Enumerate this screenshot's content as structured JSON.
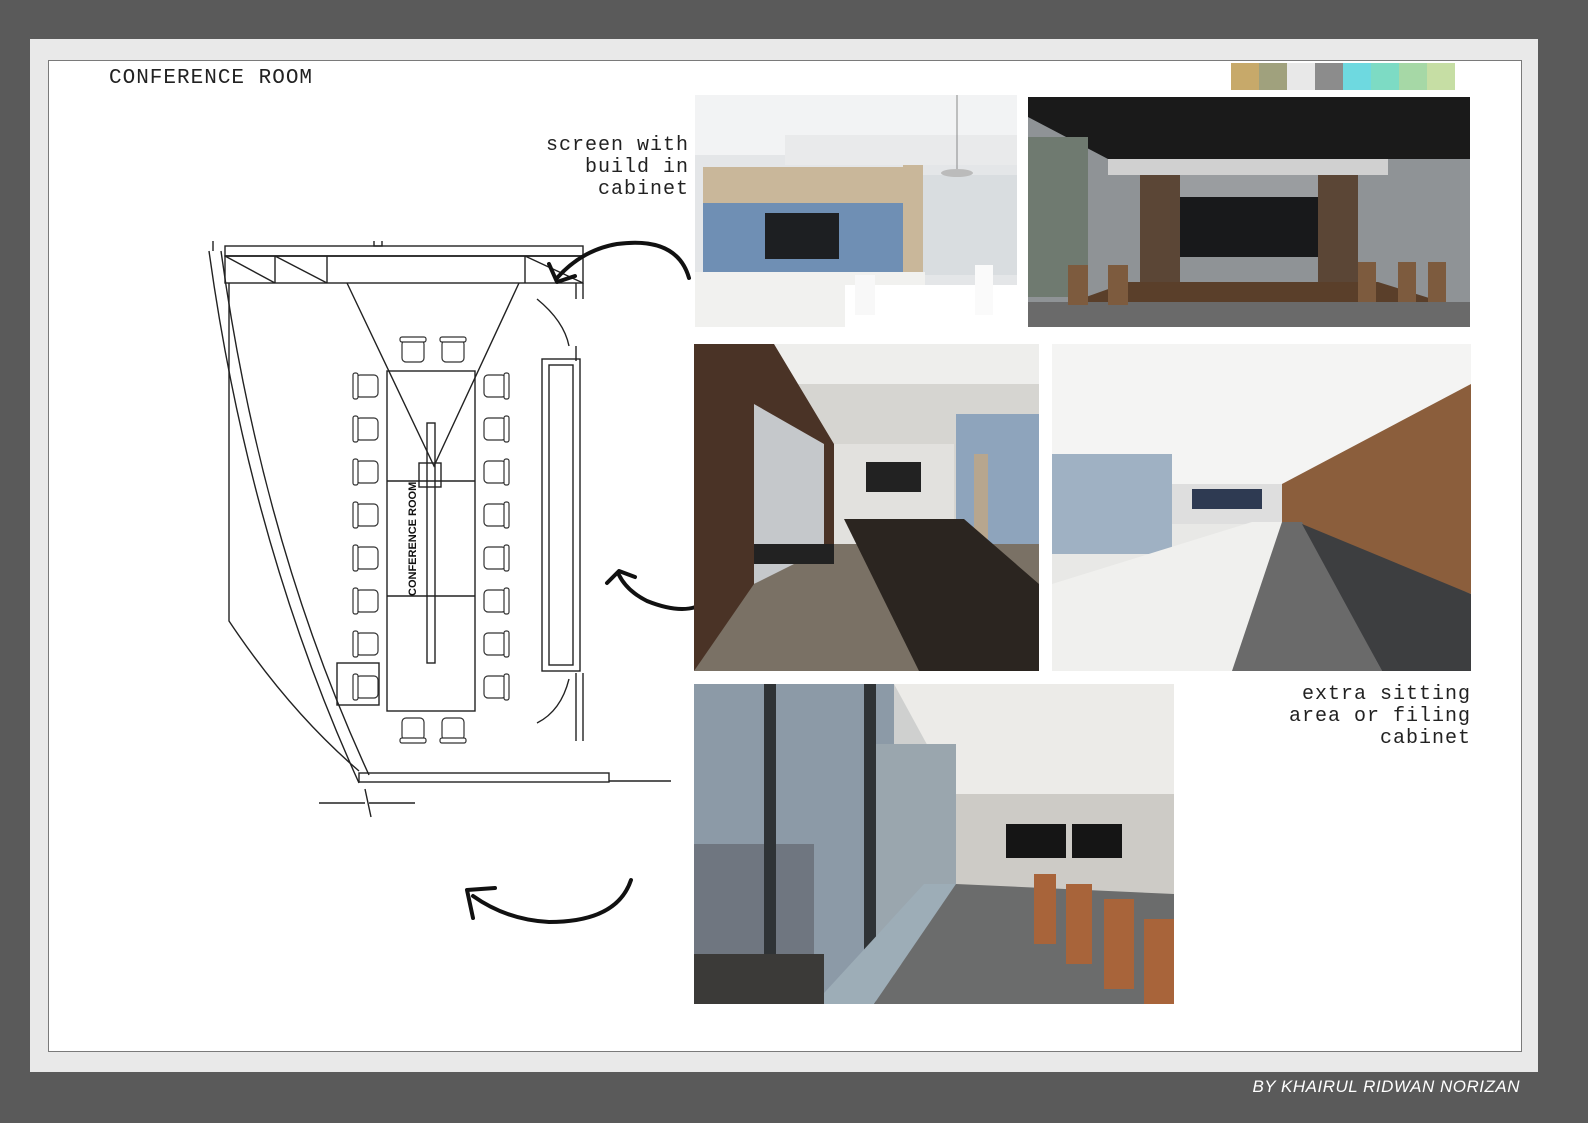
{
  "page": {
    "title": "CONFERENCE ROOM",
    "credit": "BY   KHAIRUL RIDWAN NORIZAN"
  },
  "notes": {
    "screen": "screen with\nbuild in\ncabinet",
    "sitting": "extra sitting\narea or filing\ncabinet"
  },
  "plan": {
    "room_label": "CONFERENCE ROOM"
  },
  "palette": [
    "#c7a96a",
    "#a0a17d",
    "#e8e8e8",
    "#8c8c8c",
    "#6ed9e0",
    "#7ddbc4",
    "#a6d8a6",
    "#c6dea4"
  ],
  "photos": [
    {
      "name": "photo-screen-cabinet"
    },
    {
      "name": "photo-dark-ceiling-room"
    },
    {
      "name": "photo-wood-wall-room"
    },
    {
      "name": "photo-long-white-table"
    },
    {
      "name": "photo-window-bench-room"
    }
  ]
}
